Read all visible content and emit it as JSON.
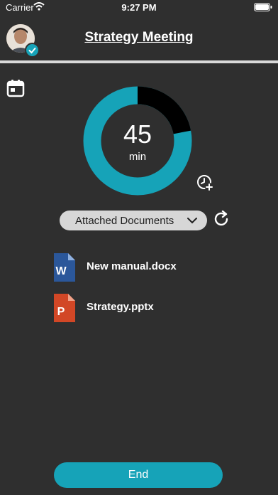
{
  "status_bar": {
    "carrier": "Carrier",
    "time": "9:27 PM"
  },
  "header": {
    "title": "Strategy Meeting"
  },
  "timer": {
    "value": "45",
    "unit": "min",
    "elapsed_fraction": 0.22
  },
  "documents": {
    "selector_label": "Attached Documents",
    "files": [
      {
        "name": "New manual.docx",
        "icon": "word-file-icon",
        "badge": "W",
        "color": "#2b579a"
      },
      {
        "name": "Strategy.pptx",
        "icon": "powerpoint-file-icon",
        "badge": "P",
        "color": "#d24726"
      }
    ]
  },
  "actions": {
    "end_label": "End"
  },
  "colors": {
    "accent": "#16a3b8",
    "background": "#2f2f2f"
  }
}
